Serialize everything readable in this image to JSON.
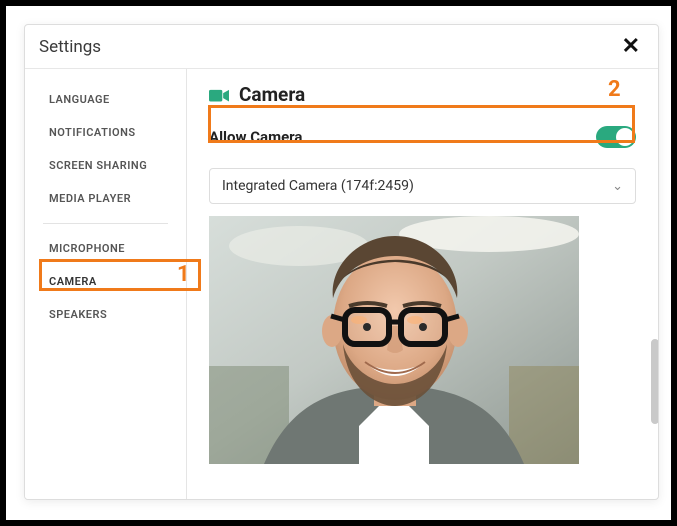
{
  "dialog": {
    "title": "Settings"
  },
  "sidebar": {
    "items": [
      {
        "label": "LANGUAGE"
      },
      {
        "label": "NOTIFICATIONS"
      },
      {
        "label": "SCREEN SHARING"
      },
      {
        "label": "MEDIA PLAYER"
      },
      {
        "label": "MICROPHONE"
      },
      {
        "label": "CAMERA"
      },
      {
        "label": "SPEAKERS"
      }
    ]
  },
  "content": {
    "heading": "Camera",
    "allow_label": "Allow Camera",
    "allow_value": true,
    "camera_select": "Integrated Camera (174f:2459)"
  },
  "annotations": {
    "n1": "1",
    "n2": "2"
  },
  "colors": {
    "accent_green": "#2aa97f",
    "highlight_orange": "#f07a1a"
  }
}
